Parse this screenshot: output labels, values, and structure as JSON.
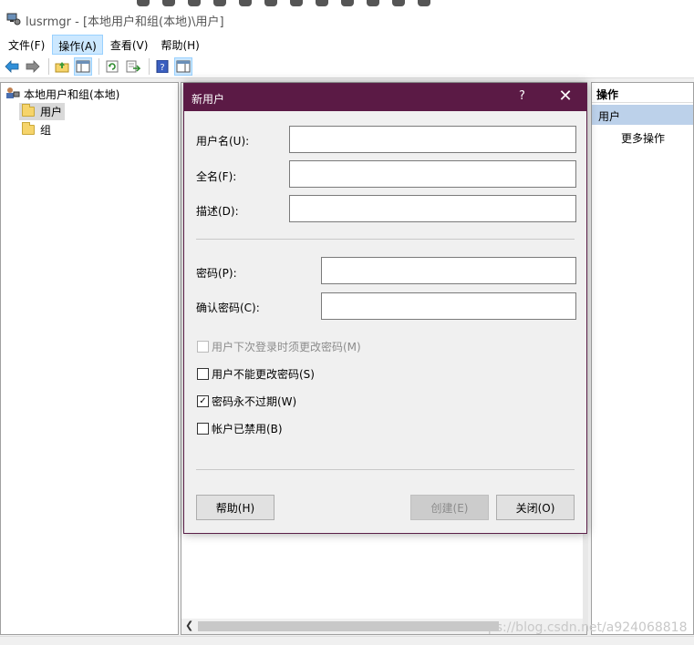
{
  "window": {
    "title": "lusrmgr - [本地用户和组(本地)\\用户]"
  },
  "menu": [
    {
      "label": "文件(F)",
      "active": false
    },
    {
      "label": "操作(A)",
      "active": true
    },
    {
      "label": "查看(V)",
      "active": false
    },
    {
      "label": "帮助(H)",
      "active": false
    }
  ],
  "toolbar_icons": [
    "back-arrow-icon",
    "forward-arrow-icon",
    "up-folder-icon",
    "show-hide-tree-icon",
    "refresh-icon",
    "export-list-icon",
    "help-icon",
    "show-hide-action-pane-icon"
  ],
  "tree": {
    "root": "本地用户和组(本地)",
    "nodes": [
      "用户",
      "组"
    ]
  },
  "actions_pane": {
    "header": "操作",
    "section": "用户",
    "more": "更多操作"
  },
  "watermark": "https://blog.csdn.net/a924068818",
  "dialog": {
    "title": "新用户",
    "help_glyph": "?",
    "close_glyph": "✕",
    "fields": {
      "username": {
        "label": "用户名(U):",
        "value": ""
      },
      "fullname": {
        "label": "全名(F):",
        "value": ""
      },
      "description": {
        "label": "描述(D):",
        "value": ""
      },
      "password": {
        "label": "密码(P):",
        "value": ""
      },
      "confirm": {
        "label": "确认密码(C):",
        "value": ""
      }
    },
    "checkboxes": [
      {
        "label": "用户下次登录时须更改密码(M)",
        "checked": false,
        "disabled": true
      },
      {
        "label": "用户不能更改密码(S)",
        "checked": false,
        "disabled": false
      },
      {
        "label": "密码永不过期(W)",
        "checked": true,
        "disabled": false
      },
      {
        "label": "帐户已禁用(B)",
        "checked": false,
        "disabled": false
      }
    ],
    "buttons": {
      "help": "帮助(H)",
      "create": "创建(E)",
      "close": "关闭(O)"
    }
  },
  "colors": {
    "dialog_titlebar": "#5b1a45",
    "action_section": "#bcd1ea",
    "menu_active": "#cce8ff"
  }
}
